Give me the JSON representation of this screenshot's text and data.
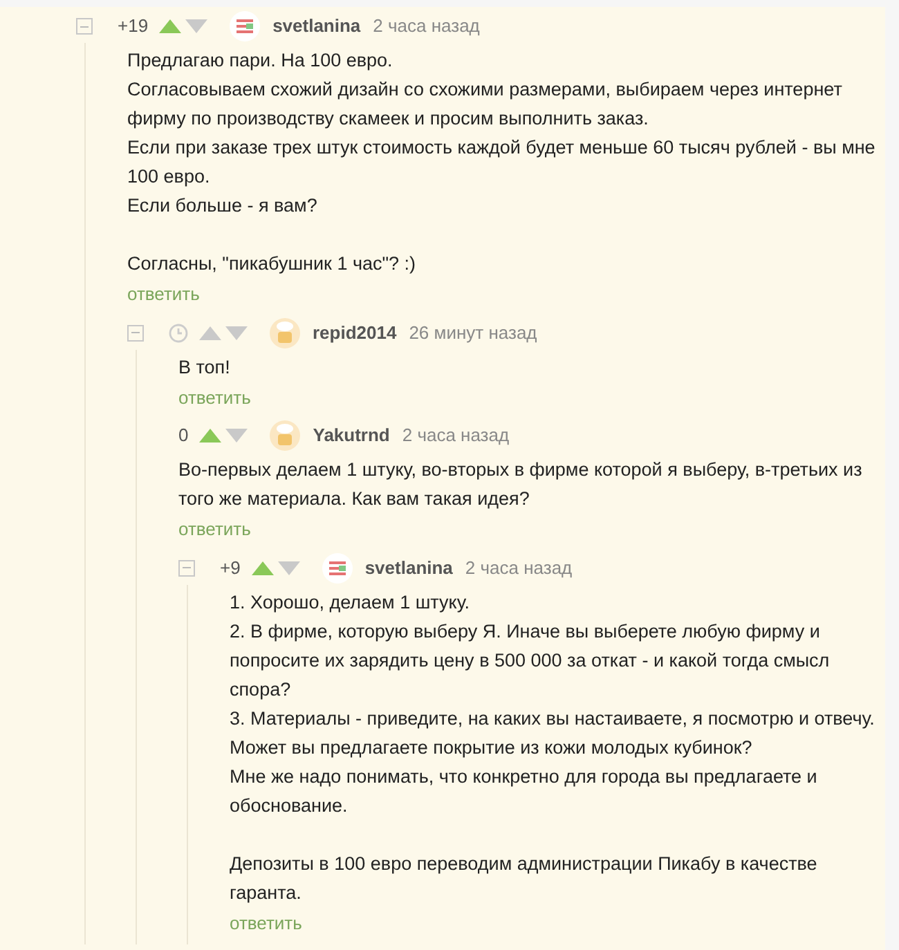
{
  "comments": [
    {
      "collapsible": true,
      "rating": "+19",
      "upvoted": true,
      "avatar": {
        "kind": "striped"
      },
      "author": "svetlanina",
      "time": "2 часа назад",
      "blocks": [
        [
          "Предлагаю пари. На 100 евро.",
          "Согласовываем схожий дизайн со схожими размерами, выбираем через интернет фирму по производству скамеек и просим выполнить заказ.",
          "Если при заказе трех штук стоимость каждой будет меньше 60 тысяч рублей - вы мне 100 евро.",
          "Если больше - я вам?"
        ],
        [
          "Согласны, \"пикабушник 1 час\"? :)"
        ]
      ],
      "reply": "ответить",
      "children": [
        {
          "collapsible": true,
          "upvoted": false,
          "avatar": {
            "kind": "chef"
          },
          "author": "repid2014",
          "time": "26 минут назад",
          "blocks": [
            [
              "В топ!"
            ]
          ],
          "reply": "ответить",
          "children": [
            {
              "collapsible": false,
              "rating": "0",
              "upvoted": true,
              "avatar": {
                "kind": "chef"
              },
              "author": "Yakutrnd",
              "time": "2 часа назад",
              "blocks": [
                [
                  "Во-первых делаем 1 штуку, во-вторых в фирме которой я выберу, в-третьих из того же материала. Как вам такая идея?"
                ]
              ],
              "reply": "ответить"
            },
            {
              "collapsible": true,
              "rating": "+9",
              "upvoted": true,
              "avatar": {
                "kind": "striped"
              },
              "author": "svetlanina",
              "time": "2 часа назад",
              "blocks": [
                [
                  "1. Хорошо, делаем 1 штуку.",
                  "2. В фирме, которую выберу Я. Иначе вы выберете любую фирму и попросите их зарядить цену в 500 000 за откат - и какой тогда смысл спора?",
                  "3. Материалы - приведите, на каких вы настаиваете, я посмотрю и отвечу. Может вы предлагаете покрытие из кожи молодых кубинок?",
                  "Мне же надо понимать, что конкретно для города вы предлагаете и обоснование."
                ],
                [
                  "Депозиты в 100 евро переводим администрации Пикабу в качестве гаранта."
                ]
              ],
              "reply": "ответить"
            }
          ]
        }
      ]
    }
  ]
}
